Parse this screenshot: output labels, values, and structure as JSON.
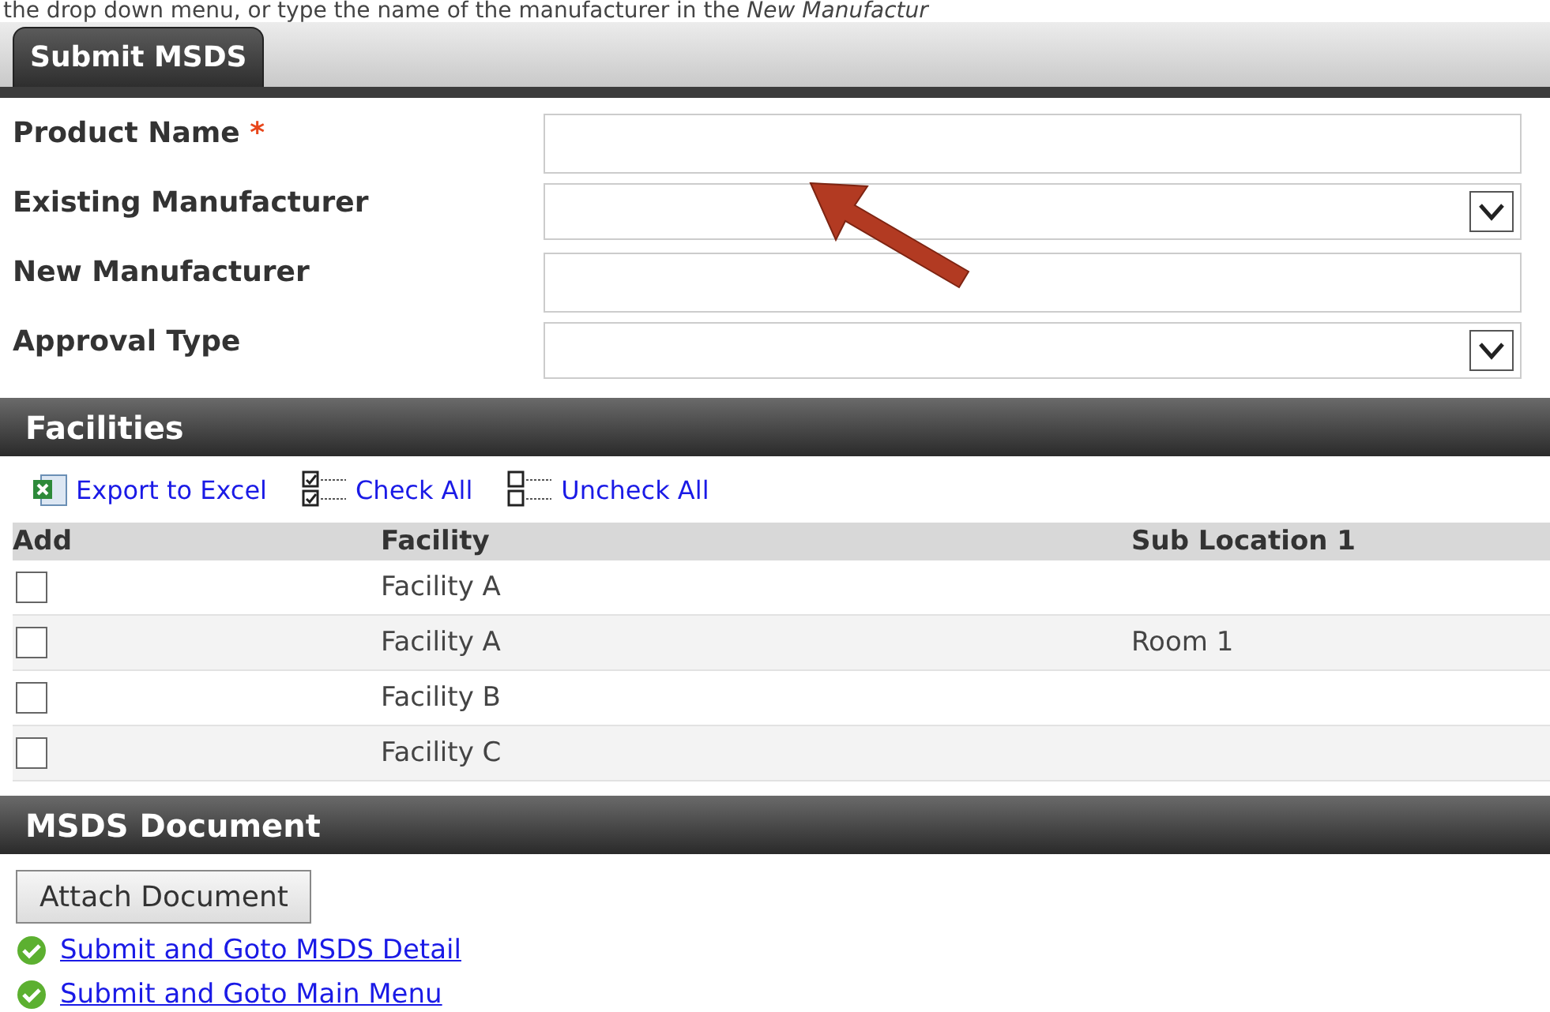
{
  "intro_text": "the drop down menu, or type the name of the manufacturer in the *New Manufactur*",
  "tabs": [
    {
      "label": "Submit MSDS",
      "selected": true
    }
  ],
  "form": {
    "fields": [
      {
        "label": "Product Name",
        "required": true,
        "kind": "text"
      },
      {
        "label": "Existing Manufacturer",
        "required": false,
        "kind": "select"
      },
      {
        "label": "New Manufacturer",
        "required": false,
        "kind": "text"
      },
      {
        "label": "Approval Type",
        "required": false,
        "kind": "select"
      }
    ],
    "required_mark": "*"
  },
  "facilities": {
    "title": "Facilities",
    "toolbar": [
      {
        "label": "Export to Excel",
        "kind": "excel"
      },
      {
        "label": "Check All",
        "kind": "check"
      },
      {
        "label": "Uncheck All",
        "kind": "uncheck"
      }
    ],
    "columns": [
      "Add",
      "Facility",
      "Sub Location 1"
    ],
    "rows": [
      {
        "checked": false,
        "facility": "Facility A"
      },
      {
        "checked": false,
        "facility": "Facility A",
        "sub_location": "Room 1"
      },
      {
        "checked": false,
        "facility": "Facility B"
      },
      {
        "checked": false,
        "facility": "Facility C"
      }
    ]
  },
  "document": {
    "title": "MSDS Document",
    "button": "Attach Document",
    "links": [
      "Submit and Goto MSDS Detail",
      "Submit and Goto Main Menu"
    ]
  }
}
